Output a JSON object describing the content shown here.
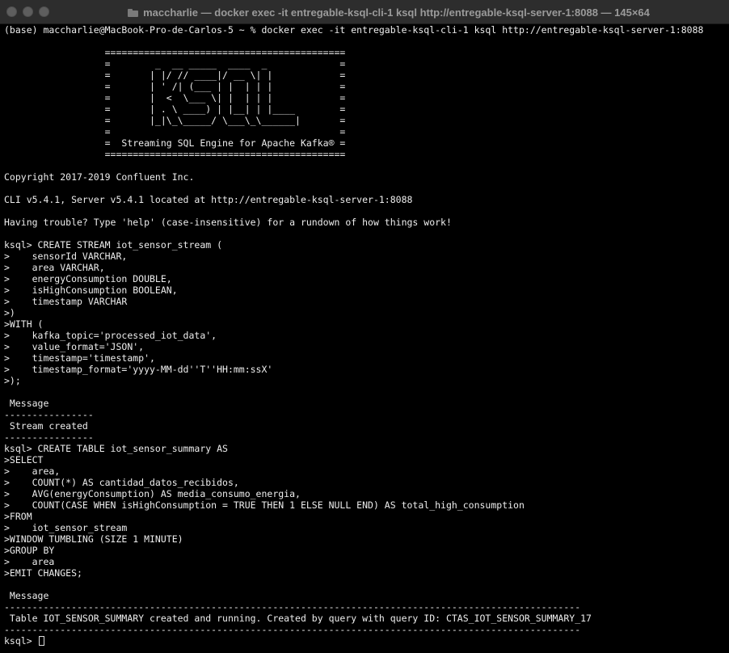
{
  "window": {
    "title": "maccharlie — docker exec -it entregable-ksql-cli-1 ksql http://entregable-ksql-server-1:8088 — 145×64"
  },
  "terminal": {
    "lines": [
      "(base) maccharlie@MacBook-Pro-de-Carlos-5 ~ % docker exec -it entregable-ksql-cli-1 ksql http://entregable-ksql-server-1:8088",
      "",
      "                  ===========================================",
      "                  =        _  __ _____  ____  _             =",
      "                  =       | |/ // ____|/ __ \\| |            =",
      "                  =       | ' /| (___ | |  | | |            =",
      "                  =       |  <  \\___ \\| |  | | |            =",
      "                  =       | . \\ ____) | |__| | |____        =",
      "                  =       |_|\\_\\_____/ \\___\\_\\______|       =",
      "                  =                                         =",
      "                  =  Streaming SQL Engine for Apache Kafka® =",
      "                  ===========================================",
      "",
      "Copyright 2017-2019 Confluent Inc.",
      "",
      "CLI v5.4.1, Server v5.4.1 located at http://entregable-ksql-server-1:8088",
      "",
      "Having trouble? Type 'help' (case-insensitive) for a rundown of how things work!",
      "",
      "ksql> CREATE STREAM iot_sensor_stream (",
      ">    sensorId VARCHAR,",
      ">    area VARCHAR,",
      ">    energyConsumption DOUBLE,",
      ">    isHighConsumption BOOLEAN,",
      ">    timestamp VARCHAR",
      ">)",
      ">WITH (",
      ">    kafka_topic='processed_iot_data',",
      ">    value_format='JSON',",
      ">    timestamp='timestamp',",
      ">    timestamp_format='yyyy-MM-dd''T''HH:mm:ssX'",
      ">);",
      "",
      " Message",
      "----------------",
      " Stream created",
      "----------------",
      "ksql> CREATE TABLE iot_sensor_summary AS",
      ">SELECT",
      ">    area,",
      ">    COUNT(*) AS cantidad_datos_recibidos,",
      ">    AVG(energyConsumption) AS media_consumo_energia,",
      ">    COUNT(CASE WHEN isHighConsumption = TRUE THEN 1 ELSE NULL END) AS total_high_consumption",
      ">FROM",
      ">    iot_sensor_stream",
      ">WINDOW TUMBLING (SIZE 1 MINUTE)",
      ">GROUP BY",
      ">    area",
      ">EMIT CHANGES;",
      "",
      " Message",
      "-------------------------------------------------------------------------------------------------------",
      " Table IOT_SENSOR_SUMMARY created and running. Created by query with query ID: CTAS_IOT_SENSOR_SUMMARY_17",
      "-------------------------------------------------------------------------------------------------------"
    ],
    "prompt": "ksql> "
  }
}
